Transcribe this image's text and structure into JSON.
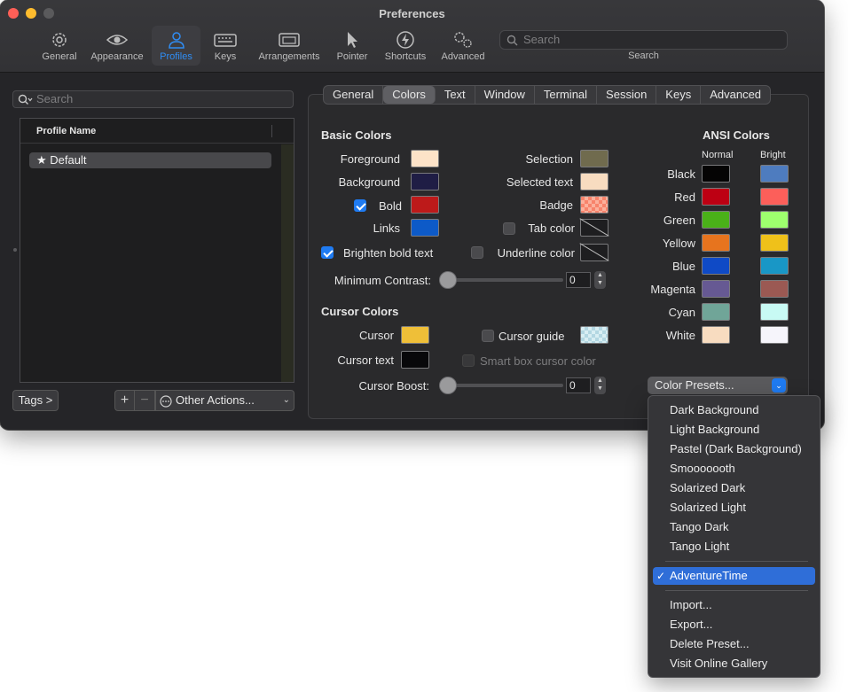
{
  "window": {
    "title": "Preferences"
  },
  "toolbar": {
    "items": [
      {
        "label": "General",
        "icon": "gear-icon",
        "active": false
      },
      {
        "label": "Appearance",
        "icon": "eye-icon",
        "active": false
      },
      {
        "label": "Profiles",
        "icon": "person-icon",
        "active": true
      },
      {
        "label": "Keys",
        "icon": "keyboard-icon",
        "active": false
      },
      {
        "label": "Arrangements",
        "icon": "windows-icon",
        "active": false
      },
      {
        "label": "Pointer",
        "icon": "pointer-icon",
        "active": false
      },
      {
        "label": "Shortcuts",
        "icon": "bolt-icon",
        "active": false
      },
      {
        "label": "Advanced",
        "icon": "gears-icon",
        "active": false
      }
    ],
    "search_placeholder": "Search",
    "search_caption": "Search"
  },
  "sidebar": {
    "search_placeholder": "Search",
    "list_header": "Profile Name",
    "profiles": [
      {
        "name": "Default",
        "star": "★"
      }
    ],
    "tags_button": "Tags >",
    "add_button": "+",
    "remove_button": "−",
    "other_actions": "Other Actions..."
  },
  "tabs": [
    "General",
    "Colors",
    "Text",
    "Window",
    "Terminal",
    "Session",
    "Keys",
    "Advanced"
  ],
  "active_tab": "Colors",
  "basic_colors": {
    "title": "Basic Colors",
    "left": [
      {
        "label": "Foreground",
        "color": "#fde3c8"
      },
      {
        "label": "Background",
        "color": "#1f1d45"
      },
      {
        "label": "Bold",
        "color": "#bd1a1a",
        "checkbox": true
      },
      {
        "label": "Links",
        "color": "#0d5ac8"
      }
    ],
    "right": [
      {
        "label": "Selection",
        "color": "#706b4e"
      },
      {
        "label": "Selected text",
        "color": "#f8dcc0"
      },
      {
        "label": "Badge",
        "color": "#f7836b"
      },
      {
        "label": "Tab color",
        "color": "none",
        "checkbox": false
      },
      {
        "label": "Underline color",
        "color": "none",
        "checkbox": false
      }
    ],
    "brighten_bold": "Brighten bold text",
    "min_contrast_label": "Minimum Contrast:",
    "min_contrast_value": "0"
  },
  "cursor_colors": {
    "title": "Cursor Colors",
    "cursor": {
      "label": "Cursor",
      "color": "#efbf38"
    },
    "cursor_text": {
      "label": "Cursor text",
      "color": "#08080a"
    },
    "cursor_guide": "Cursor guide",
    "smart_box": "Smart box cursor color",
    "boost_label": "Cursor Boost:",
    "boost_value": "0"
  },
  "ansi": {
    "title": "ANSI Colors",
    "normal_label": "Normal",
    "bright_label": "Bright",
    "rows": [
      {
        "name": "Black",
        "normal": "#050404",
        "bright": "#4e7cbf"
      },
      {
        "name": "Red",
        "normal": "#bd0013",
        "bright": "#fc5f5a"
      },
      {
        "name": "Green",
        "normal": "#4ab118",
        "bright": "#9eff6e"
      },
      {
        "name": "Yellow",
        "normal": "#e7741e",
        "bright": "#efc11a"
      },
      {
        "name": "Blue",
        "normal": "#0f4ac6",
        "bright": "#1997c6"
      },
      {
        "name": "Magenta",
        "normal": "#665993",
        "bright": "#9b5953"
      },
      {
        "name": "Cyan",
        "normal": "#70a598",
        "bright": "#c8faf4"
      },
      {
        "name": "White",
        "normal": "#f8dcc0",
        "bright": "#f6f5fb"
      }
    ]
  },
  "presets": {
    "button_label": "Color Presets...",
    "group1": [
      "Dark Background",
      "Light Background",
      "Pastel (Dark Background)",
      "Smooooooth",
      "Solarized Dark",
      "Solarized Light",
      "Tango Dark",
      "Tango Light"
    ],
    "selected": "AdventureTime",
    "check": "✓",
    "group2": [
      "Import...",
      "Export...",
      "Delete Preset...",
      "Visit Online Gallery"
    ]
  },
  "colors": {
    "accent": "#1f7bf2",
    "window_bg": "#252528",
    "menu_selected": "#2f6ed8"
  }
}
